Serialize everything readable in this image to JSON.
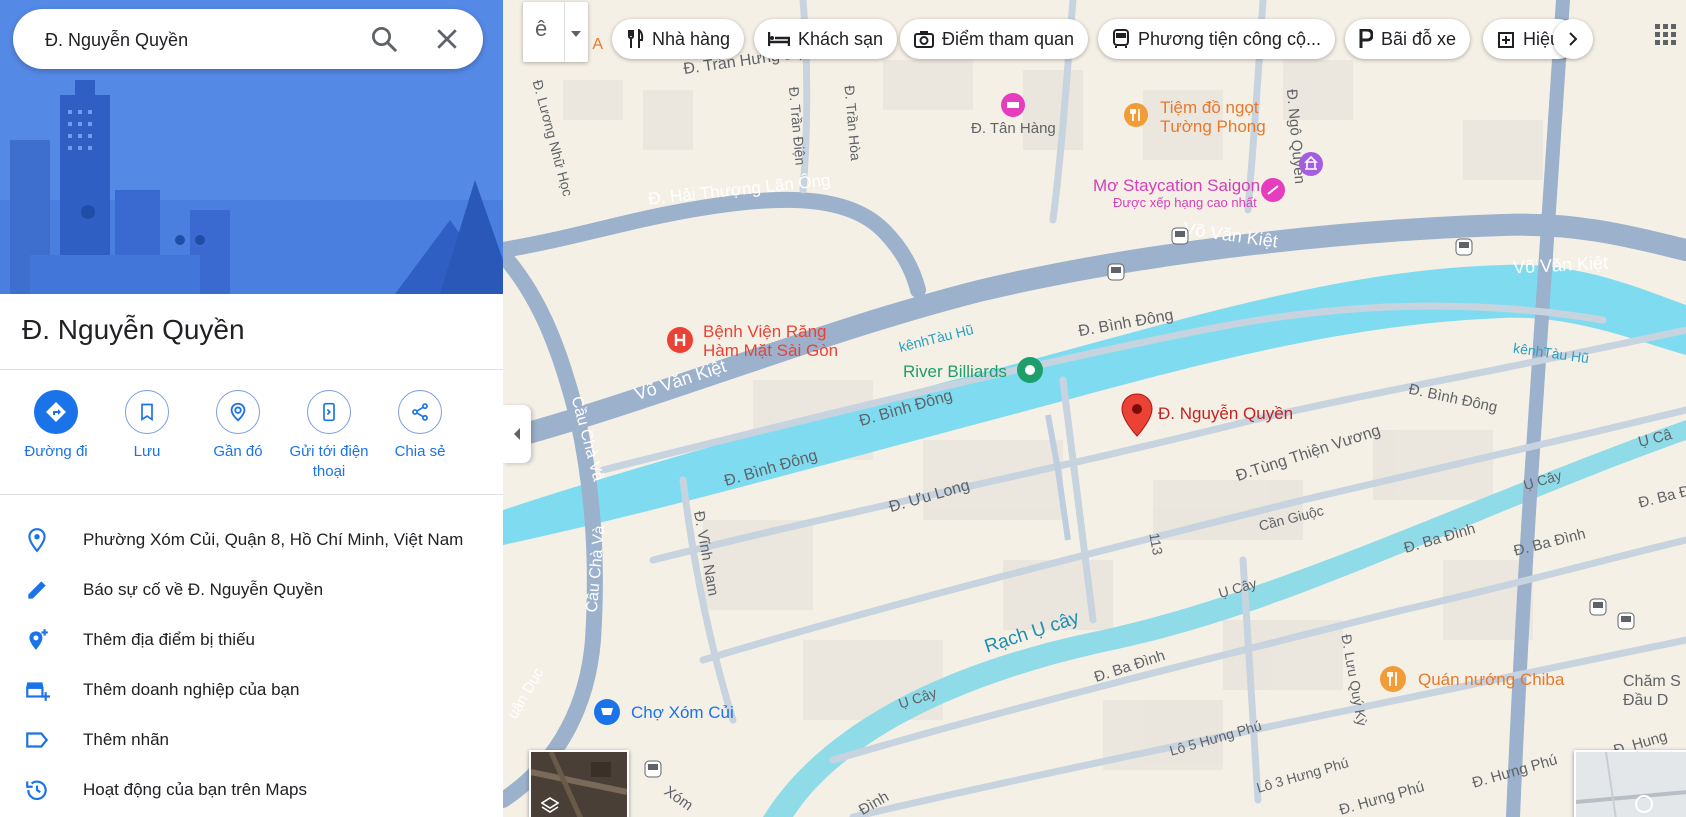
{
  "search": {
    "value": "Đ. Nguyễn Quyền"
  },
  "place": {
    "title": "Đ. Nguyễn Quyền"
  },
  "actions": [
    {
      "label": "Đường đi",
      "icon": "directions-icon"
    },
    {
      "label": "Lưu",
      "icon": "bookmark-icon"
    },
    {
      "label": "Gần đó",
      "icon": "nearby-icon"
    },
    {
      "label": "Gửi tới điện thoại",
      "icon": "send-to-phone-icon"
    },
    {
      "label": "Chia sẻ",
      "icon": "share-icon"
    }
  ],
  "info_rows": [
    {
      "text": "Phường Xóm Củi, Quận 8, Hồ Chí Minh, Việt Nam",
      "icon": "location-pin-icon"
    },
    {
      "text": "Báo sự cố về Đ. Nguyễn Quyền",
      "icon": "pencil-icon"
    },
    {
      "text": "Thêm địa điểm bị thiếu",
      "icon": "add-place-icon"
    },
    {
      "text": "Thêm doanh nghiệp của bạn",
      "icon": "add-business-icon"
    },
    {
      "text": "Thêm nhãn",
      "icon": "label-icon"
    },
    {
      "text": "Hoạt động của bạn trên Maps",
      "icon": "history-icon"
    }
  ],
  "input_tool": {
    "label": "ê"
  },
  "chips": [
    {
      "label": "Nhà hàng",
      "icon": "restaurant-icon"
    },
    {
      "label": "Khách sạn",
      "icon": "hotel-icon"
    },
    {
      "label": "Điểm tham quan",
      "icon": "camera-icon"
    },
    {
      "label": "Phương tiện công cộ...",
      "icon": "transit-icon"
    },
    {
      "label": "Bãi đỗ xe",
      "icon": "parking-icon"
    },
    {
      "label": "Hiệu",
      "icon": "pharmacy-icon"
    }
  ],
  "map_labels": {
    "tran_hung_dao": "Đ. Trần Hưng Đạo",
    "tan_hang": "Đ. Tân Hàng",
    "hai_thuong_lan_ong": "Đ. Hải Thượng Lãn Ông",
    "luong_nhu_hoc": "Đ. Lương Nhữ Học",
    "tran_dien": "Đ. Trần Điện",
    "tran_hoa": "Đ. Trần Hòa",
    "ngo_quyen": "Đ. Ngô Quyền",
    "vo_van_kiet_1": "Võ Văn Kiệt",
    "vo_van_kiet_2": "Võ Văn Kiệt",
    "vo_van_kiet_3": "Võ Văn Kiệt",
    "kenh_tau_hu_1": "kênhTàu Hũ",
    "kenh_tau_hu_2": "kênhTàu Hũ",
    "binh_dong_1": "Đ. Bình Đông",
    "binh_dong_2": "Đ. Bình Đông",
    "binh_dong_3": "Đ. Bình Đông",
    "binh_dong_4": "Đ. Bình Đông",
    "cau_cha_va_1": "Cầu Chà Và",
    "cau_cha_va_2": "Cầu Chà Và",
    "uu_long": "Đ. Ưu Long",
    "vinh_nam": "Đ. Vĩnh Nam",
    "tung_thien_vuong": "Đ.Tùng Thiện Vương",
    "can_giuoc": "Cần Giuộc",
    "road_113": "113",
    "u_cay_1": "Ụ Cây",
    "u_cay_2": "Ụ Cây",
    "u_cay_3": "Ụ Cây",
    "rach_u_cay": "Rạch Ụ cây",
    "ba_dinh_1": "Đ. Ba Đình",
    "ba_dinh_2": "Đ. Ba Đình",
    "ba_dinh_3": "Đ. Ba Đình",
    "ba_dinh_4": "Đ. Ba Đì",
    "luu_quy_ky": "Đ. Lưu Quý Kỳ",
    "lo5_hung_phu": "Lô 5 Hưng Phú",
    "lo3_hung_phu": "Lô 3 Hưng Phú",
    "hung_phu_1": "Đ. Hưng Phú",
    "hung_phu_2": "Đ. Hưng Phú",
    "hung_phu_3": "Đ. Hung",
    "dinh": "Đình",
    "xom": "Xóm",
    "duan_duc": "uận Dục",
    "u_ca_edge": "Ụ Câ",
    "ng_edge": "ng A"
  },
  "pois": {
    "tiem_do_ngot_1": "Tiệm đồ ngọt",
    "tiem_do_ngot_2": "Tường Phong",
    "mo_staycation": "Mơ Staycation Saigon",
    "mo_rating": "Được xếp hạng cao nhất",
    "benh_vien_1": "Bệnh Viện Răng",
    "benh_vien_2": "Hàm Mặt Sài Gòn",
    "river_billiards": "River Billiards",
    "selected_pin": "Đ. Nguyễn Quyền",
    "cho_xom_cui": "Chợ Xóm Củi",
    "quan_nuong": "Quán nướng Chiba",
    "cham_s_1": "Chăm S",
    "cham_s_2": "Đầu D"
  },
  "colors": {
    "accent": "#1a73e8",
    "water": "#7fdcf0",
    "road": "#9cb1cc",
    "land": "#f5f0e6",
    "pin": "#ea4335",
    "food_poi": "#f29c38",
    "pink_poi": "#e63dbf",
    "green_poi": "#1e9e6a"
  }
}
